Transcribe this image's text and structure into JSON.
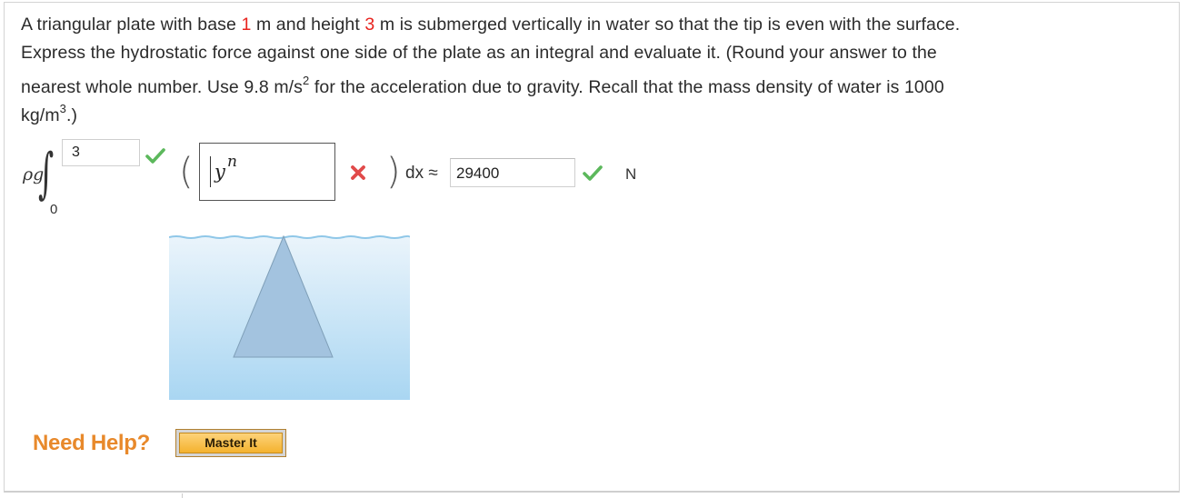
{
  "question": {
    "p1": "A triangular plate with base ",
    "base": "1",
    "p2": " m and height ",
    "height": "3",
    "p3": " m is submerged vertically in water so that the tip is even with the surface.",
    "line2": "Express the hydrostatic force against one side of the plate as an integral and evaluate it. (Round your answer to the",
    "line3_a": "nearest whole number. Use 9.8 m/s",
    "line3_sup": "2",
    "line3_b": " for the acceleration due to gravity. Recall that the mass density of water is 1000",
    "line4_a": "kg/m",
    "line4_sup": "3",
    "line4_b": ".)"
  },
  "integral": {
    "rho_g": "ρg",
    "lower_limit": "0",
    "upper_limit_value": "3",
    "upper_status": "correct",
    "open_paren": "(",
    "close_paren": ")",
    "expr_base": "y",
    "expr_exponent": "n",
    "expr_status": "incorrect",
    "dx_label": "dx ≈",
    "answer_value": "29400",
    "answer_status": "correct",
    "unit": "N"
  },
  "help": {
    "need_help": "Need Help?",
    "master_it": "Master It"
  },
  "colors": {
    "accent_red": "#e8231e",
    "check_green": "#5cb85c",
    "cross_red": "#e14a4a",
    "help_orange": "#e8892b",
    "water_top": "#eaf4fb",
    "water_bottom": "#a9d6f2",
    "plate": "#a3c3df"
  }
}
